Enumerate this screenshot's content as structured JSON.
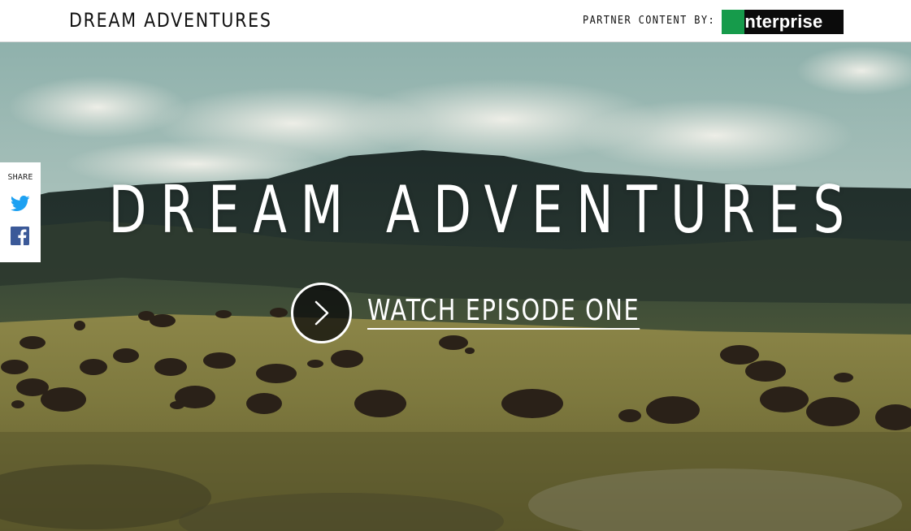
{
  "header": {
    "brand": "DREAM ADVENTURES",
    "partner_label": "PARTNER CONTENT BY:",
    "partner_logo_text": "enterprise",
    "partner_logo_colors": {
      "background": "#0b0b0b",
      "accent": "#169b4b",
      "text": "#ffffff"
    }
  },
  "share": {
    "label": "SHARE",
    "buttons": [
      {
        "icon": "twitter-icon",
        "color": "#1da1f2"
      },
      {
        "icon": "facebook-icon",
        "color": "#3b5998"
      }
    ]
  },
  "hero": {
    "title": "DREAM ADVENTURES",
    "cta_label": "WATCH EPISODE ONE",
    "cta_icon": "chevron-right-icon"
  }
}
